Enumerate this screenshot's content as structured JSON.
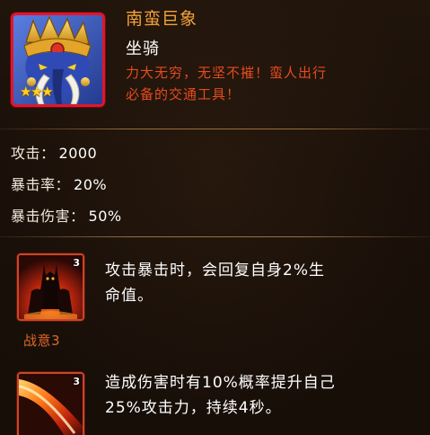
{
  "mount": {
    "name": "南蛮巨象",
    "type": "坐骑",
    "description_lines": [
      "力大无穷，无坚不摧！蛮人出行",
      "必备的交通工具！"
    ],
    "star_count": 3,
    "star_color": "#ffd21f",
    "frame_color": "#e0162b"
  },
  "stats": [
    {
      "label": "攻击：",
      "value": "2000"
    },
    {
      "label": "暴击率：",
      "value": "20%"
    },
    {
      "label": "暴击伤害：",
      "value": "50%"
    }
  ],
  "skills": [
    {
      "icon": "demon-warrior-icon",
      "level": "3",
      "name": "战意3",
      "description_lines": [
        "攻击暴击时，会回复自身2%生",
        "命值。"
      ]
    },
    {
      "icon": "fire-slash-icon",
      "level": "3",
      "name": "",
      "description_lines": [
        "造成伤害时有10%概率提升自己",
        "25%攻击力，持续4秒。"
      ]
    }
  ],
  "colors": {
    "title": "#f3a23a",
    "description": "#e54b1e",
    "skill_name": "#e0672b",
    "background": "#1a1009"
  }
}
